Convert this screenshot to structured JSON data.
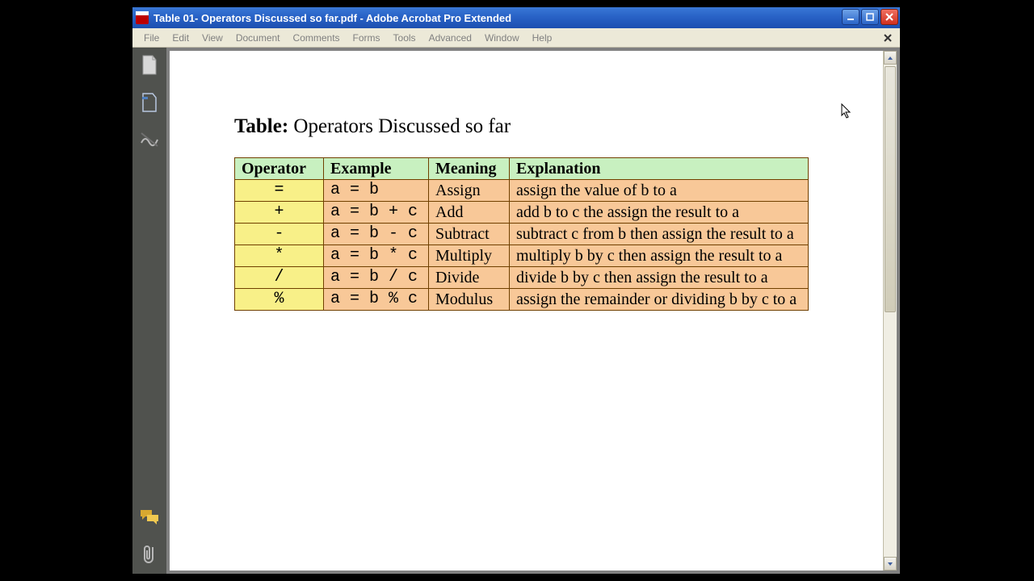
{
  "window": {
    "title": "Table 01- Operators Discussed so far.pdf - Adobe Acrobat Pro Extended"
  },
  "menu": {
    "items": [
      "File",
      "Edit",
      "View",
      "Document",
      "Comments",
      "Forms",
      "Tools",
      "Advanced",
      "Window",
      "Help"
    ]
  },
  "document": {
    "title_prefix": "Table:",
    "title_rest": " Operators Discussed so far",
    "table": {
      "headers": [
        "Operator",
        "Example",
        "Meaning",
        "Explanation"
      ],
      "rows": [
        {
          "op": "=",
          "ex": "a = b",
          "meaning": "Assign",
          "expl": "assign the value of b to a"
        },
        {
          "op": "+",
          "ex": "a = b + c",
          "meaning": "Add",
          "expl": "add b to c the assign the result to a"
        },
        {
          "op": "-",
          "ex": "a = b - c",
          "meaning": "Subtract",
          "expl": "subtract c from b then assign the result to a"
        },
        {
          "op": "*",
          "ex": "a = b * c",
          "meaning": "Multiply",
          "expl": "multiply b by c then assign the result to a"
        },
        {
          "op": "/",
          "ex": "a = b / c",
          "meaning": "Divide",
          "expl": "divide b by c then assign the result to a"
        },
        {
          "op": "%",
          "ex": "a = b % c",
          "meaning": "Modulus",
          "expl": "assign the remainder or dividing b by c to a"
        }
      ]
    }
  },
  "nav_panel_icons": [
    "pages-icon",
    "bookmarks-icon",
    "signatures-icon",
    "comments-icon",
    "attachments-icon"
  ]
}
